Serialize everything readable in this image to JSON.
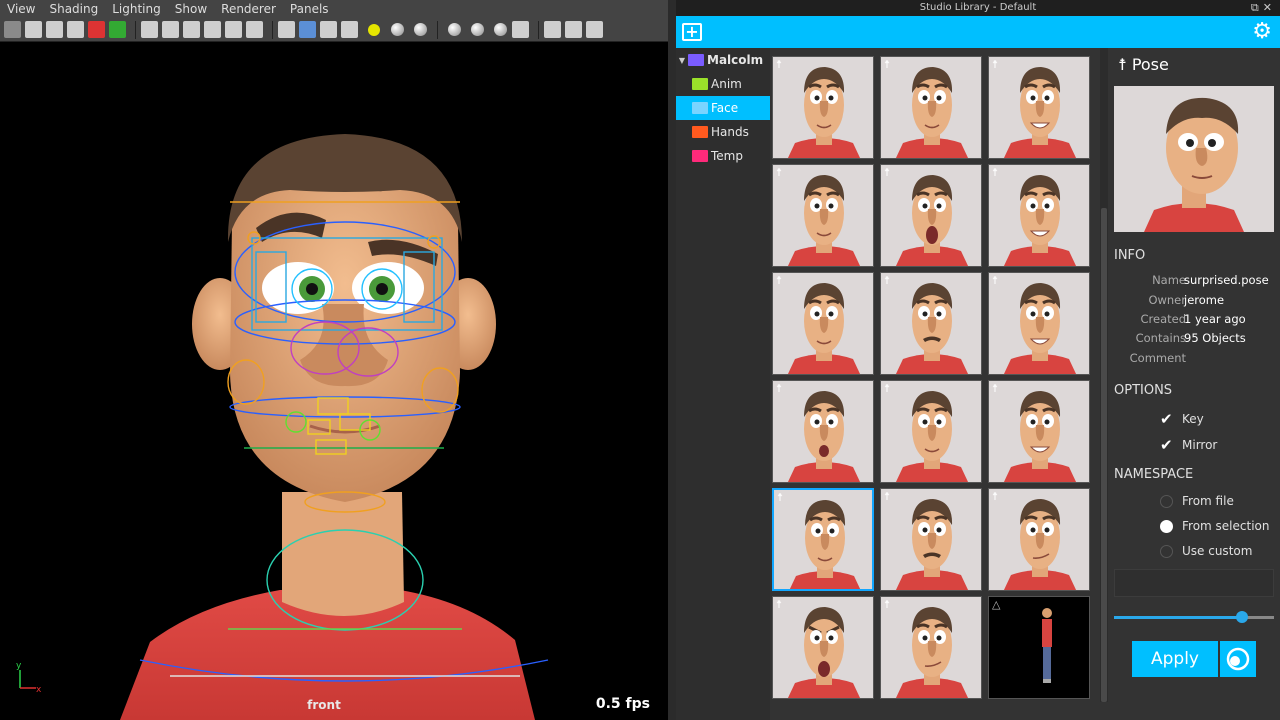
{
  "maya": {
    "menu": [
      "View",
      "Shading",
      "Lighting",
      "Show",
      "Renderer",
      "Panels"
    ],
    "camera_label": "front",
    "fps_label": "0.5 fps",
    "axis": {
      "y": "y",
      "x": "x"
    }
  },
  "library": {
    "window_title": "Studio Library - Default",
    "window_buttons": "⧉✕",
    "add_icon": "+",
    "settings_icon": "⚙",
    "tree": [
      {
        "label": "Malcolm",
        "color": "#7a5cff",
        "root": true,
        "arrow": "▼"
      },
      {
        "label": "Anim",
        "color": "#9be12a"
      },
      {
        "label": "Face",
        "color": "#7ad4ff",
        "selected": true
      },
      {
        "label": "Hands",
        "color": "#ff5a1f"
      },
      {
        "label": "Temp",
        "color": "#ff2a7a"
      }
    ],
    "thumbnails": {
      "pin_glyph": "☨",
      "warning_glyph": "△",
      "selected_index": 12,
      "dark_index": 17,
      "expressions": [
        "smile",
        "neutral",
        "grin",
        "smile",
        "shout",
        "grin",
        "neutral",
        "mustache",
        "grin",
        "open",
        "smile",
        "grin",
        "smile",
        "mustache",
        "smirk",
        "angry",
        "smirk",
        "full-body"
      ]
    },
    "preview": {
      "pin_glyph": "☨",
      "title": "Pose",
      "info_header": "INFO",
      "info": [
        {
          "key": "Name",
          "value": "surprised.pose"
        },
        {
          "key": "Owner",
          "value": "jerome"
        },
        {
          "key": "Created",
          "value": "1 year ago"
        },
        {
          "key": "Contains",
          "value": "95 Objects"
        },
        {
          "key": "Comment",
          "value": ""
        }
      ],
      "options_header": "OPTIONS",
      "options": [
        {
          "label": "Key",
          "checked": true
        },
        {
          "label": "Mirror",
          "checked": true
        }
      ],
      "check_glyph": "✔",
      "namespace_header": "NAMESPACE",
      "namespace_options": [
        {
          "label": "From file",
          "selected": false
        },
        {
          "label": "From selection",
          "selected": true
        },
        {
          "label": "Use custom",
          "selected": false
        }
      ],
      "blend_fraction": 0.8,
      "apply_label": "Apply"
    }
  }
}
